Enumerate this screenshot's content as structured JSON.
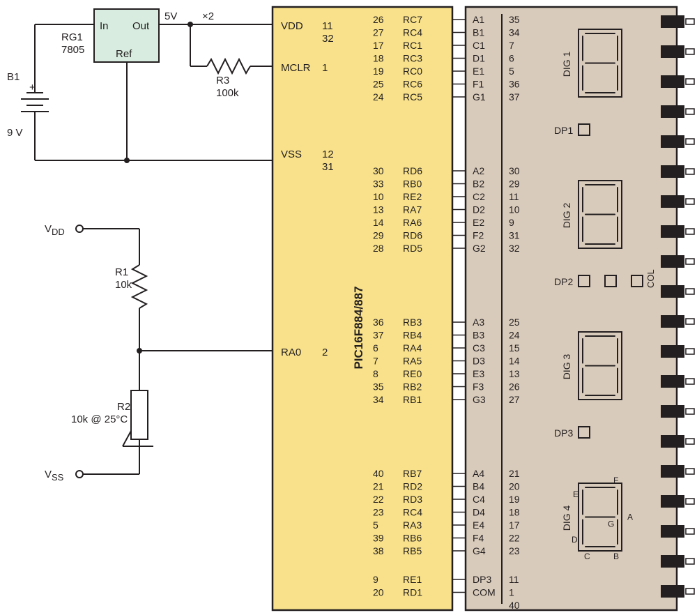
{
  "battery": {
    "name": "B1",
    "value": "9 V"
  },
  "regulator": {
    "name": "RG1",
    "part": "7805",
    "in": "In",
    "out": "Out",
    "ref": "Ref",
    "vout": "5V",
    "x2": "×2"
  },
  "r3": {
    "name": "R3",
    "value": "100k"
  },
  "r1": {
    "name": "R1",
    "value": "10k"
  },
  "r2": {
    "name": "R2",
    "value": "10k @ 25°C"
  },
  "vdd": "V",
  "dd": "DD",
  "vss": "V",
  "ss": "SS",
  "chip": {
    "part": "PIC16F884/887",
    "leftPins": [
      {
        "lbl": "VDD",
        "num": [
          "11",
          "32"
        ]
      },
      {
        "lbl": "MCLR",
        "num": [
          "1"
        ]
      },
      {
        "lbl": "VSS",
        "num": [
          "12",
          "31"
        ]
      },
      {
        "lbl": "RA0",
        "num": [
          "2"
        ]
      }
    ],
    "blocks": [
      [
        [
          "26",
          "RC7"
        ],
        [
          "27",
          "RC4"
        ],
        [
          "17",
          "RC1"
        ],
        [
          "18",
          "RC3"
        ],
        [
          "19",
          "RC0"
        ],
        [
          "25",
          "RC6"
        ],
        [
          "24",
          "RC5"
        ]
      ],
      [
        [
          "30",
          "RD6"
        ],
        [
          "33",
          "RB0"
        ],
        [
          "10",
          "RE2"
        ],
        [
          "13",
          "RA7"
        ],
        [
          "14",
          "RA6"
        ],
        [
          "29",
          "RD6"
        ],
        [
          "28",
          "RD5"
        ]
      ],
      [
        [
          "36",
          "RB3"
        ],
        [
          "37",
          "RB4"
        ],
        [
          "6",
          "RA4"
        ],
        [
          "7",
          "RA5"
        ],
        [
          "8",
          "RE0"
        ],
        [
          "35",
          "RB2"
        ],
        [
          "34",
          "RB1"
        ]
      ],
      [
        [
          "40",
          "RB7"
        ],
        [
          "21",
          "RD2"
        ],
        [
          "22",
          "RD3"
        ],
        [
          "23",
          "RC4"
        ],
        [
          "5",
          "RA3"
        ],
        [
          "39",
          "RB6"
        ],
        [
          "38",
          "RB5"
        ]
      ],
      [
        [
          "9",
          "RE1"
        ],
        [
          "20",
          "RD1"
        ]
      ]
    ]
  },
  "display": {
    "blocks": [
      {
        "dig": "DIG 1",
        "dp": "DP1",
        "rows": [
          [
            "A1",
            "35"
          ],
          [
            "B1",
            "34"
          ],
          [
            "C1",
            "7"
          ],
          [
            "D1",
            "6"
          ],
          [
            "E1",
            "5"
          ],
          [
            "F1",
            "36"
          ],
          [
            "G1",
            "37"
          ]
        ]
      },
      {
        "dig": "DIG 2",
        "dp": "DP2",
        "rows": [
          [
            "A2",
            "30"
          ],
          [
            "B2",
            "29"
          ],
          [
            "C2",
            "11"
          ],
          [
            "D2",
            "10"
          ],
          [
            "E2",
            "9"
          ],
          [
            "F2",
            "31"
          ],
          [
            "G2",
            "32"
          ]
        ]
      },
      {
        "dig": "DIG 3",
        "dp": "DP3",
        "rows": [
          [
            "A3",
            "25"
          ],
          [
            "B3",
            "24"
          ],
          [
            "C3",
            "15"
          ],
          [
            "D3",
            "14"
          ],
          [
            "E3",
            "13"
          ],
          [
            "F3",
            "26"
          ],
          [
            "G3",
            "27"
          ]
        ]
      },
      {
        "dig": "DIG 4",
        "dp": "",
        "rows": [
          [
            "A4",
            "21"
          ],
          [
            "B4",
            "20"
          ],
          [
            "C4",
            "19"
          ],
          [
            "D4",
            "18"
          ],
          [
            "E4",
            "17"
          ],
          [
            "F4",
            "22"
          ],
          [
            "G4",
            "23"
          ]
        ]
      }
    ],
    "extra": [
      [
        "DP3",
        "11"
      ],
      [
        "COM",
        "1"
      ],
      [
        "",
        "40"
      ]
    ],
    "col": "COL",
    "segLabels": [
      "A",
      "B",
      "C",
      "D",
      "E",
      "F",
      "G"
    ]
  }
}
